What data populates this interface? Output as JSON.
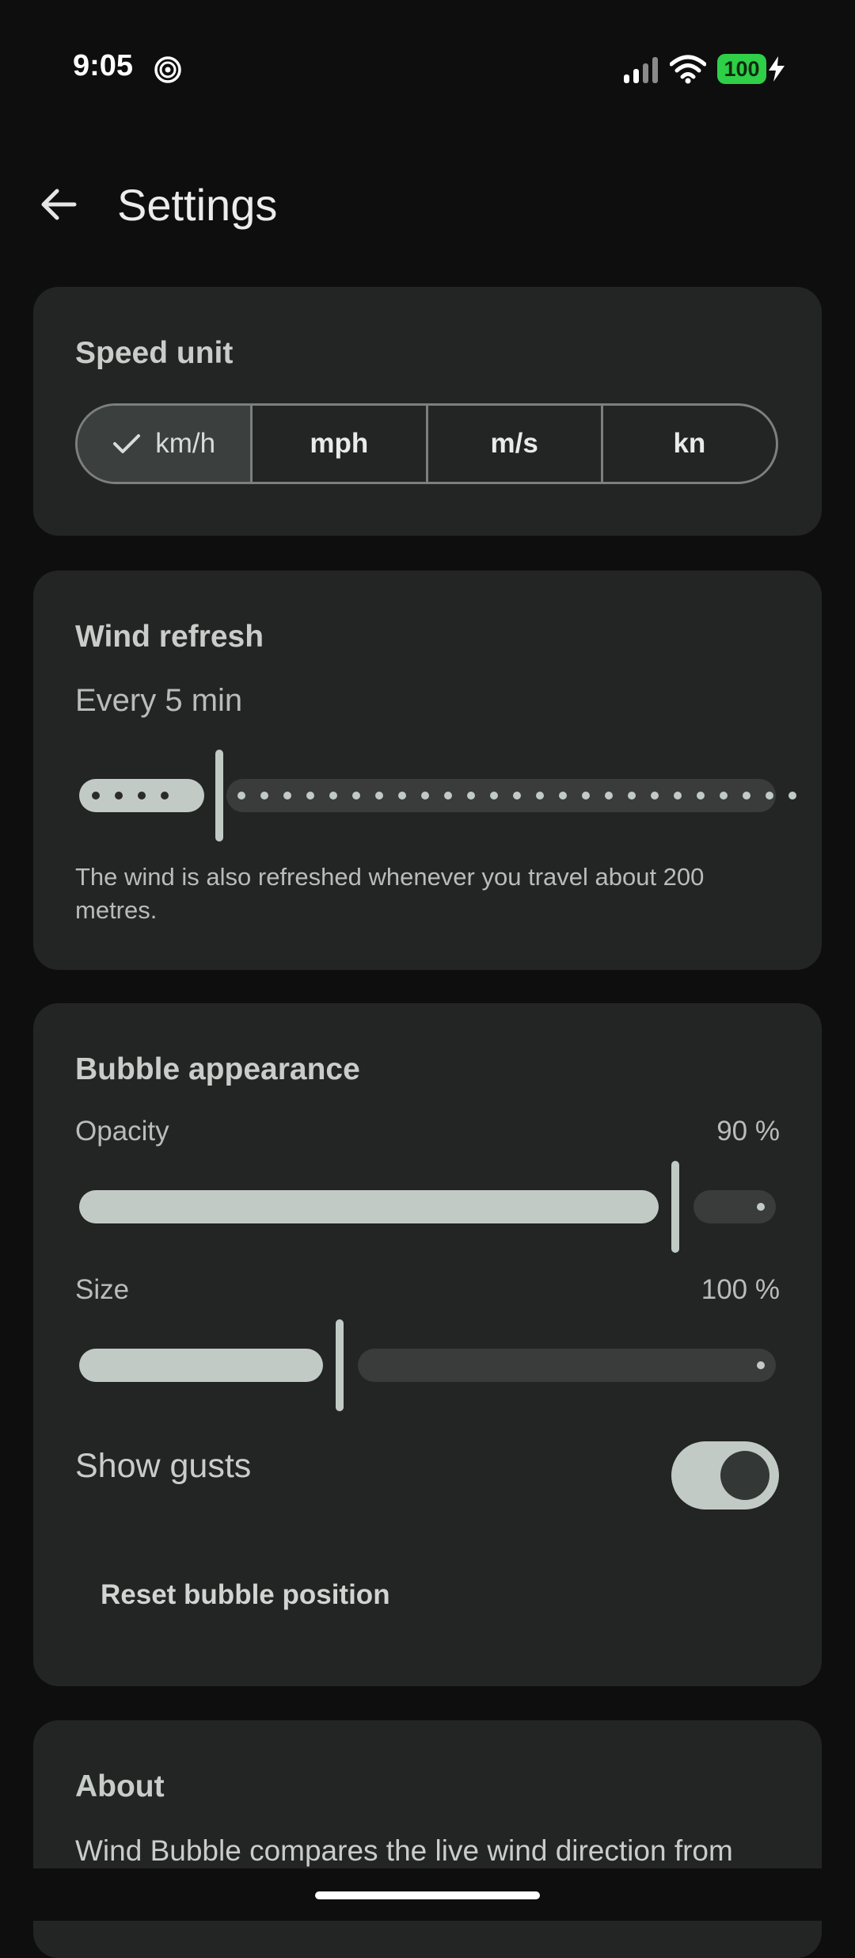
{
  "status_bar": {
    "time": "9:05",
    "battery_level": "100"
  },
  "app_bar": {
    "title": "Settings"
  },
  "speed_unit": {
    "title": "Speed unit",
    "options": [
      "km/h",
      "mph",
      "m/s",
      "kn"
    ],
    "selected": "km/h"
  },
  "wind_refresh": {
    "title": "Wind refresh",
    "value_text": "Every 5 min",
    "slider_position_fraction": 0.15,
    "help": "The wind is also refreshed whenever you travel about 200 metres."
  },
  "bubble_appearance": {
    "title": "Bubble appearance",
    "opacity_label": "Opacity",
    "opacity_value": "90 %",
    "opacity_fraction": 0.87,
    "size_label": "Size",
    "size_value": "100 %",
    "size_fraction": 0.38,
    "gusts_label": "Show gusts",
    "gusts_enabled": true,
    "reset_label": "Reset bubble position"
  },
  "about": {
    "title": "About",
    "text": "Wind Bubble compares the live wind direction from"
  },
  "colors": {
    "background": "#0e0e0e",
    "card": "#232424",
    "accent": "#c2cac5",
    "battery": "#2fcf48"
  }
}
